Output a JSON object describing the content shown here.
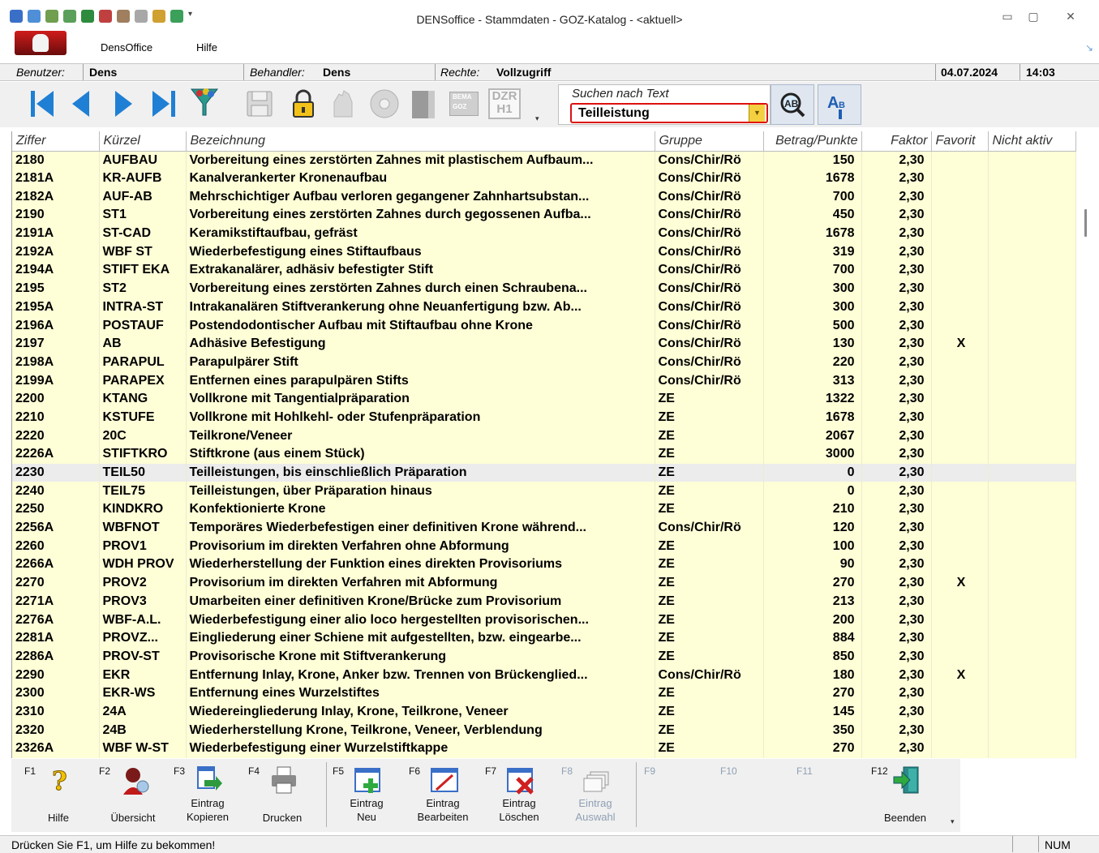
{
  "window": {
    "title": "DENSoffice -  Stammdaten - GOZ-Katalog - <aktuell>",
    "minimize": "▭",
    "maximize": "▢",
    "close": "✕"
  },
  "menu": {
    "items": [
      "DensOffice",
      "Hilfe"
    ]
  },
  "infobar": {
    "user_label": "Benutzer:",
    "user_value": "Dens",
    "therapist_label": "Behandler:",
    "therapist_value": "Dens",
    "rights_label": "Rechte:",
    "rights_value": "Vollzugriff",
    "date": "04.07.2024",
    "time": "14:03"
  },
  "toolbar": {
    "icons": [
      "first-record-icon",
      "previous-record-icon",
      "next-record-icon",
      "last-record-icon",
      "filter-icon",
      "save-icon",
      "lock-icon",
      "hand-icon",
      "disc-icon",
      "erstattung-icon",
      "bema-goz-icon",
      "dzr-h1-icon"
    ],
    "badge_bema": "BEMA",
    "badge_goz": "GOZ",
    "badge_dzr": "DZR",
    "badge_h1": "H1",
    "search_label": "Suchen nach Text",
    "search_value": "Teilleistung"
  },
  "table": {
    "columns": [
      "Ziffer",
      "Kürzel",
      "Bezeichnung",
      "Gruppe",
      "Betrag/Punkte",
      "Faktor",
      "Favorit",
      "Nicht aktiv"
    ],
    "selected_row": 17,
    "rows": [
      [
        "2180",
        "AUFBAU",
        "Vorbereitung eines zerstörten Zahnes mit plastischem Aufbaum...",
        "Cons/Chir/Rö",
        "150",
        "2,30",
        "",
        ""
      ],
      [
        "2181A",
        "KR-AUFB",
        "Kanalverankerter Kronenaufbau",
        "Cons/Chir/Rö",
        "1678",
        "2,30",
        "",
        ""
      ],
      [
        "2182A",
        "AUF-AB",
        "Mehrschichtiger Aufbau verloren gegangener Zahnhartsubstan...",
        "Cons/Chir/Rö",
        "700",
        "2,30",
        "",
        ""
      ],
      [
        "2190",
        "ST1",
        "Vorbereitung eines zerstörten Zahnes durch gegossenen Aufba...",
        "Cons/Chir/Rö",
        "450",
        "2,30",
        "",
        ""
      ],
      [
        "2191A",
        "ST-CAD",
        "Keramikstiftaufbau, gefräst",
        "Cons/Chir/Rö",
        "1678",
        "2,30",
        "",
        ""
      ],
      [
        "2192A",
        "WBF ST",
        "Wiederbefestigung eines Stiftaufbaus",
        "Cons/Chir/Rö",
        "319",
        "2,30",
        "",
        ""
      ],
      [
        "2194A",
        "STIFT EKA",
        "Extrakanalärer, adhäsiv befestigter Stift",
        "Cons/Chir/Rö",
        "700",
        "2,30",
        "",
        ""
      ],
      [
        "2195",
        "ST2",
        "Vorbereitung eines zerstörten Zahnes durch einen Schraubena...",
        "Cons/Chir/Rö",
        "300",
        "2,30",
        "",
        ""
      ],
      [
        "2195A",
        "INTRA-ST",
        "Intrakanalären Stiftverankerung ohne Neuanfertigung bzw. Ab...",
        "Cons/Chir/Rö",
        "300",
        "2,30",
        "",
        ""
      ],
      [
        "2196A",
        "POSTAUF",
        "Postendodontischer Aufbau mit Stiftaufbau ohne Krone",
        "Cons/Chir/Rö",
        "500",
        "2,30",
        "",
        ""
      ],
      [
        "2197",
        "AB",
        "Adhäsive Befestigung",
        "Cons/Chir/Rö",
        "130",
        "2,30",
        "X",
        ""
      ],
      [
        "2198A",
        "PARAPUL",
        "Parapulpärer Stift",
        "Cons/Chir/Rö",
        "220",
        "2,30",
        "",
        ""
      ],
      [
        "2199A",
        "PARAPEX",
        "Entfernen eines parapulpären Stifts",
        "Cons/Chir/Rö",
        "313",
        "2,30",
        "",
        ""
      ],
      [
        "2200",
        "KTANG",
        "Vollkrone mit Tangentialpräparation",
        "ZE",
        "1322",
        "2,30",
        "",
        ""
      ],
      [
        "2210",
        "KSTUFE",
        "Vollkrone mit Hohlkehl- oder Stufenpräparation",
        "ZE",
        "1678",
        "2,30",
        "",
        ""
      ],
      [
        "2220",
        "20C",
        "Teilkrone/Veneer",
        "ZE",
        "2067",
        "2,30",
        "",
        ""
      ],
      [
        "2226A",
        "STIFTKRO",
        "Stiftkrone (aus einem Stück)",
        "ZE",
        "3000",
        "2,30",
        "",
        ""
      ],
      [
        "2230",
        "TEIL50",
        "Teilleistungen, bis einschließlich Präparation",
        "ZE",
        "0",
        "2,30",
        "",
        ""
      ],
      [
        "2240",
        "TEIL75",
        "Teilleistungen, über Präparation hinaus",
        "ZE",
        "0",
        "2,30",
        "",
        ""
      ],
      [
        "2250",
        "KINDKRO",
        "Konfektionierte Krone",
        "ZE",
        "210",
        "2,30",
        "",
        ""
      ],
      [
        "2256A",
        "WBFNOT",
        "Temporäres Wiederbefestigen einer definitiven Krone während...",
        "Cons/Chir/Rö",
        "120",
        "2,30",
        "",
        ""
      ],
      [
        "2260",
        "PROV1",
        "Provisorium im direkten Verfahren ohne Abformung",
        "ZE",
        "100",
        "2,30",
        "",
        ""
      ],
      [
        "2266A",
        "WDH PROV",
        "Wiederherstellung der Funktion eines direkten Provisoriums",
        "ZE",
        "90",
        "2,30",
        "",
        ""
      ],
      [
        "2270",
        "PROV2",
        "Provisorium im direkten Verfahren mit Abformung",
        "ZE",
        "270",
        "2,30",
        "X",
        ""
      ],
      [
        "2271A",
        "PROV3",
        "Umarbeiten einer definitiven Krone/Brücke zum Provisorium",
        "ZE",
        "213",
        "2,30",
        "",
        ""
      ],
      [
        "2276A",
        "WBF-A.L.",
        "Wiederbefestigung einer alio loco hergestellten provisorischen...",
        "ZE",
        "200",
        "2,30",
        "",
        ""
      ],
      [
        "2281A",
        "PROVZ...",
        "Eingliederung einer Schiene mit aufgestellten, bzw. eingearbe...",
        "ZE",
        "884",
        "2,30",
        "",
        ""
      ],
      [
        "2286A",
        "PROV-ST",
        "Provisorische Krone mit Stiftverankerung",
        "ZE",
        "850",
        "2,30",
        "",
        ""
      ],
      [
        "2290",
        "EKR",
        "Entfernung Inlay, Krone, Anker bzw. Trennen von Brückenglied...",
        "Cons/Chir/Rö",
        "180",
        "2,30",
        "X",
        ""
      ],
      [
        "2300",
        "EKR-WS",
        "Entfernung eines Wurzelstiftes",
        "ZE",
        "270",
        "2,30",
        "",
        ""
      ],
      [
        "2310",
        "24A",
        "Wiedereingliederung Inlay, Krone, Teilkrone, Veneer",
        "ZE",
        "145",
        "2,30",
        "",
        ""
      ],
      [
        "2320",
        "24B",
        "Wiederherstellung Krone, Teilkrone, Veneer, Verblendung",
        "ZE",
        "350",
        "2,30",
        "",
        ""
      ],
      [
        "2326A",
        "WBF W-ST",
        "Wiederbefestigung einer Wurzelstiftkappe",
        "ZE",
        "270",
        "2,30",
        "",
        ""
      ]
    ]
  },
  "fkeys": [
    {
      "key": "F1",
      "label": "Hilfe",
      "icon": "help-icon"
    },
    {
      "key": "F2",
      "label": "Übersicht",
      "icon": "overview-icon"
    },
    {
      "key": "F3",
      "label": "Eintrag\nKopieren",
      "icon": "copy-entry-icon"
    },
    {
      "key": "F4",
      "label": "Drucken",
      "icon": "print-icon"
    },
    {
      "key": "F5",
      "label": "Eintrag\nNeu",
      "icon": "new-entry-icon"
    },
    {
      "key": "F6",
      "label": "Eintrag\nBearbeiten",
      "icon": "edit-entry-icon"
    },
    {
      "key": "F7",
      "label": "Eintrag\nLöschen",
      "icon": "delete-entry-icon"
    },
    {
      "key": "F8",
      "label": "Eintrag\nAuswahl",
      "icon": "select-entry-icon"
    },
    {
      "key": "F9",
      "label": "",
      "icon": ""
    },
    {
      "key": "F10",
      "label": "",
      "icon": ""
    },
    {
      "key": "F11",
      "label": "",
      "icon": ""
    },
    {
      "key": "F12",
      "label": "Beenden",
      "icon": "exit-door-icon"
    }
  ],
  "status": {
    "message": "Drücken Sie F1, um Hilfe zu bekommen!",
    "num": "NUM"
  },
  "colors": {
    "row_background": "#fefed7",
    "selected_row": "#ececec",
    "search_highlight": "#dd1111",
    "toolbar_blue": "#1f7fd4"
  }
}
